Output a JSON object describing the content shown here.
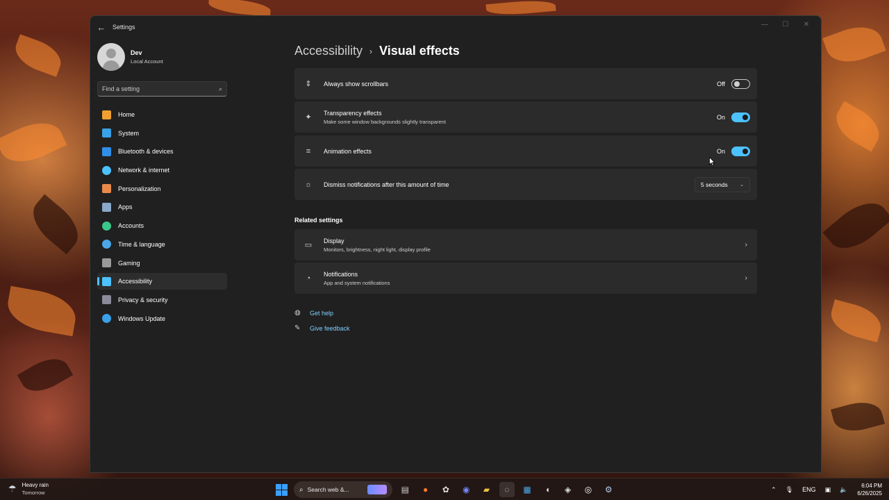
{
  "window": {
    "app_title": "Settings",
    "back_glyph": "←",
    "controls": {
      "minimize": "—",
      "maximize": "☐",
      "close": "✕"
    }
  },
  "profile": {
    "name": "Dev",
    "subtitle": "Local Account"
  },
  "search": {
    "placeholder": "Find a setting",
    "icon": "search-icon"
  },
  "sidebar": {
    "items": [
      {
        "label": "Home",
        "icon": "home-icon",
        "color": "#f0a030",
        "active": false
      },
      {
        "label": "System",
        "icon": "system-icon",
        "color": "#3aa0e8",
        "active": false
      },
      {
        "label": "Bluetooth & devices",
        "icon": "bluetooth-icon",
        "color": "#2f8fe8",
        "active": false
      },
      {
        "label": "Network & internet",
        "icon": "wifi-icon",
        "color": "#4cc2ff",
        "active": false
      },
      {
        "label": "Personalization",
        "icon": "brush-icon",
        "color": "#e88a4a",
        "active": false
      },
      {
        "label": "Apps",
        "icon": "apps-icon",
        "color": "#8aa8c8",
        "active": false
      },
      {
        "label": "Accounts",
        "icon": "accounts-icon",
        "color": "#3ac88a",
        "active": false
      },
      {
        "label": "Time & language",
        "icon": "globe-icon",
        "color": "#4aa8e8",
        "active": false
      },
      {
        "label": "Gaming",
        "icon": "gamepad-icon",
        "color": "#9a9a9a",
        "active": false
      },
      {
        "label": "Accessibility",
        "icon": "accessibility-icon",
        "color": "#4cc2ff",
        "active": true
      },
      {
        "label": "Privacy & security",
        "icon": "shield-icon",
        "color": "#8a8a9a",
        "active": false
      },
      {
        "label": "Windows Update",
        "icon": "update-icon",
        "color": "#3aa0e8",
        "active": false
      }
    ]
  },
  "breadcrumb": {
    "parent": "Accessibility",
    "separator": "›",
    "current": "Visual effects"
  },
  "settings": [
    {
      "title": "Always show scrollbars",
      "description": "",
      "icon": "scrollbar-icon",
      "glyph": "⇕",
      "control": "toggle",
      "state_label": "Off",
      "on": false
    },
    {
      "title": "Transparency effects",
      "description": "Make some window backgrounds slightly transparent",
      "icon": "transparency-icon",
      "glyph": "✦",
      "control": "toggle",
      "state_label": "On",
      "on": true
    },
    {
      "title": "Animation effects",
      "description": "",
      "icon": "animation-icon",
      "glyph": "≡",
      "control": "toggle",
      "state_label": "On",
      "on": true
    },
    {
      "title": "Dismiss notifications after this amount of time",
      "description": "",
      "icon": "sun-icon",
      "glyph": "☼",
      "control": "dropdown",
      "selected": "5 seconds",
      "chevron": "⌄"
    }
  ],
  "related": {
    "title": "Related settings",
    "items": [
      {
        "title": "Display",
        "description": "Monitors, brightness, night light, display profile",
        "icon": "display-icon",
        "glyph": "▭",
        "chevron": "›"
      },
      {
        "title": "Notifications",
        "description": "App and system notifications",
        "icon": "bell-icon",
        "glyph": "◔",
        "chevron": "›"
      }
    ]
  },
  "help": {
    "get_help": {
      "label": "Get help",
      "icon": "help-icon",
      "glyph": "◍"
    },
    "feedback": {
      "label": "Give feedback",
      "icon": "feedback-icon",
      "glyph": "✎"
    }
  },
  "taskbar": {
    "weather": {
      "title": "Heavy rain",
      "subtitle": "Tomorrow",
      "icon": "rain-cloud-icon",
      "glyph": "☂"
    },
    "search_label": "Search web &...",
    "apps": [
      {
        "name": "file-explorer-icon",
        "glyph": "▤",
        "color": "#d0d0d0"
      },
      {
        "name": "firefox-icon",
        "glyph": "●",
        "color": "#ff7a2a"
      },
      {
        "name": "chatgpt-icon",
        "glyph": "✿",
        "color": "#e0e0e0"
      },
      {
        "name": "discord-icon",
        "glyph": "◉",
        "color": "#7289ff"
      },
      {
        "name": "folder-icon",
        "glyph": "▰",
        "color": "#f2c040"
      },
      {
        "name": "settings-active-icon",
        "glyph": "◌",
        "color": "#e0e0e0"
      },
      {
        "name": "notepad-icon",
        "glyph": "▦",
        "color": "#4aa8e8"
      },
      {
        "name": "mouse-icon",
        "glyph": "◖",
        "color": "#e0e0e0"
      },
      {
        "name": "steam-icon",
        "glyph": "◈",
        "color": "#e0e0e0"
      },
      {
        "name": "obs-icon",
        "glyph": "◎",
        "color": "#ffffff"
      },
      {
        "name": "gear-icon",
        "glyph": "⚙",
        "color": "#b0c8e8"
      }
    ],
    "tray": {
      "chevron": "⌃",
      "mic": "🎙",
      "language": "ENG",
      "network": "▣",
      "volume": "🔈"
    },
    "clock": {
      "time": "6:04 PM",
      "date": "6/26/2025"
    }
  }
}
